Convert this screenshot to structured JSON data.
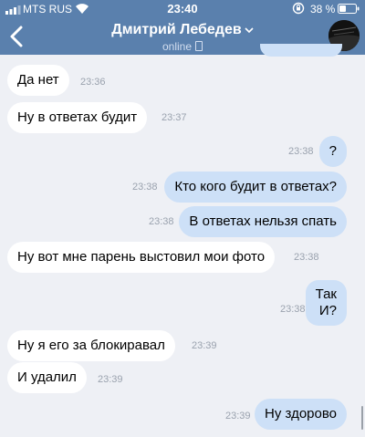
{
  "status_bar": {
    "carrier": "MTS RUS",
    "time": "23:40",
    "battery": "38 %"
  },
  "chat": {
    "name": "Дмитрий Лебедев",
    "status": "online"
  },
  "messages": [
    {
      "side": "in",
      "text": "Да нет",
      "time": "23:36"
    },
    {
      "side": "in",
      "text": "Ну в ответах будит",
      "time": "23:37"
    },
    {
      "side": "out",
      "text": "?",
      "time": "23:38"
    },
    {
      "side": "out",
      "text": "Кто кого будит в ответах?",
      "time": "23:38"
    },
    {
      "side": "out",
      "text": "В ответах нельзя спать",
      "time": "23:38"
    },
    {
      "side": "in",
      "text": "Ну вот мне парень выстовил мои фото",
      "time": "23:38"
    },
    {
      "side": "out",
      "lines": [
        "Так",
        "И?"
      ],
      "time": "23:38"
    },
    {
      "side": "in",
      "text": "Ну я его за блокиравал",
      "time": "23:39"
    },
    {
      "side": "in",
      "text": "И удалил",
      "time": "23:39"
    },
    {
      "side": "out",
      "text": "Ну здорово",
      "time": "23:39"
    }
  ],
  "colors": {
    "header": "#5a80ad",
    "background": "#eef0f5",
    "outgoing": "#cde0f7",
    "incoming": "#ffffff"
  }
}
